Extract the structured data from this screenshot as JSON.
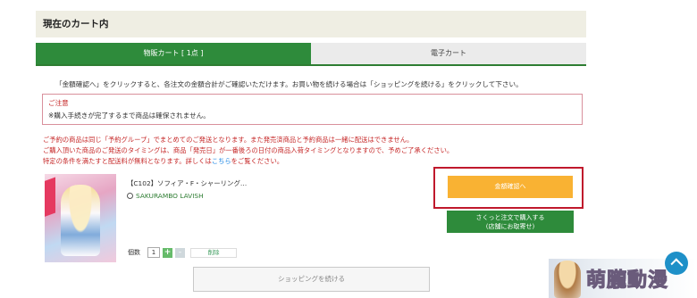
{
  "header": {
    "title": "現在のカート内"
  },
  "tabs": [
    {
      "label": "物販カート [ 1点 ]"
    },
    {
      "label": "電子カート"
    }
  ],
  "intro_text": "「金額確認へ」をクリックすると、各注文の金額合計がご確認いただけます。お買い物を続ける場合は「ショッピングを続ける」をクリックして下さい。",
  "notice": {
    "title": "ご注意",
    "text": "※購入手続きが完了するまで商品は確保されません。"
  },
  "reserve_notice": {
    "line1": "ご予約の商品は同じ「予約グループ」でまとめてのご発送となります。また発売済商品と予約商品は一緒に配送はできません。",
    "line2": "ご購入頂いた商品のご発送のタイミングは、商品「発売日」が一番後ろの日付の商品入荷タイミングとなりますので、予めご了承ください。",
    "line3_prefix": "特定の条件を満たすと配送料が無料となります。詳しくは",
    "line3_link": "こちら",
    "line3_suffix": "をご覧ください。"
  },
  "product": {
    "title": "【C102】ソフィア・F・シャーリング…",
    "brand": "SAKURAMBO LAVISH",
    "qty_label": "個数",
    "qty_value": "1",
    "plus": "+",
    "minus": "-",
    "delete_label": "削除"
  },
  "buttons": {
    "checkout": "金額確認へ",
    "quick_line1": "さくっと注文で購入する",
    "quick_line2": "(店舗にお取寄せ)",
    "continue": "ショッピングを続ける"
  },
  "watermark": {
    "text": "萌朧動漫"
  },
  "colors": {
    "accent_green": "#2e8b3b",
    "checkout_orange": "#f9b233",
    "alert_red": "#c62828",
    "highlight_red": "#c0192c"
  }
}
